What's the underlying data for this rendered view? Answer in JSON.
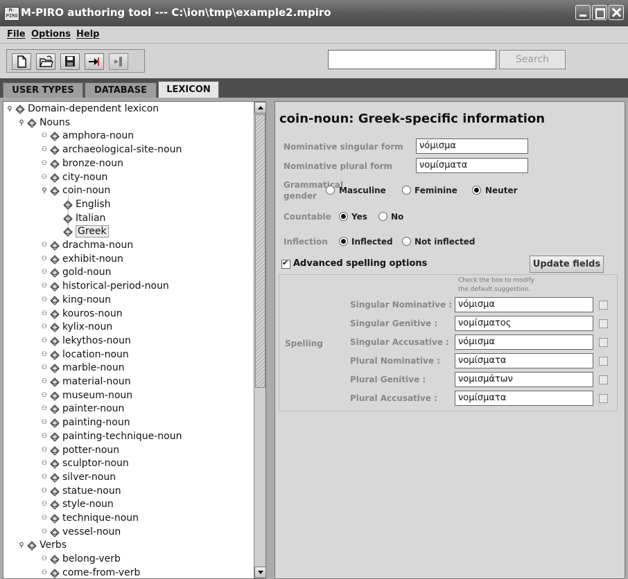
{
  "window": {
    "title": "M-PIRO authoring tool --- C:\\ion\\tmp\\example2.mpiro",
    "app_icon": "M-PIRO"
  },
  "menu": [
    "File",
    "Options",
    "Help"
  ],
  "toolbar": {
    "search_value": "",
    "search_label": "Search"
  },
  "tabs": [
    {
      "label": "USER TYPES",
      "active": false
    },
    {
      "label": "DATABASE",
      "active": false
    },
    {
      "label": "LEXICON",
      "active": true
    }
  ],
  "tree": {
    "root": "Domain-dependent lexicon",
    "nouns_label": "Nouns",
    "nouns": [
      "amphora-noun",
      "archaeological-site-noun",
      "bronze-noun",
      "city-noun",
      "coin-noun"
    ],
    "coin_children": [
      "English",
      "Italian",
      "Greek"
    ],
    "selected": "Greek",
    "nouns_after": [
      "drachma-noun",
      "exhibit-noun",
      "gold-noun",
      "historical-period-noun",
      "king-noun",
      "kouros-noun",
      "kylix-noun",
      "lekythos-noun",
      "location-noun",
      "marble-noun",
      "material-noun",
      "museum-noun",
      "painter-noun",
      "painting-noun",
      "painting-technique-noun",
      "potter-noun",
      "sculptor-noun",
      "silver-noun",
      "statue-noun",
      "style-noun",
      "technique-noun",
      "vessel-noun"
    ],
    "verbs_label": "Verbs",
    "verbs": [
      "belong-verb",
      "come-from-verb"
    ]
  },
  "detail": {
    "title": "coin-noun: Greek-specific information",
    "nom_sing_label": "Nominative singular form",
    "nom_sing_value": "νόμισμα",
    "nom_plur_label": "Nominative plural form",
    "nom_plur_value": "νομίσματα",
    "gender_label_1": "Grammatical",
    "gender_label_2": "gender",
    "gender_options": [
      "Masculine",
      "Feminine",
      "Neuter"
    ],
    "gender_selected": "Neuter",
    "countable_label": "Countable",
    "countable_options": [
      "Yes",
      "No"
    ],
    "countable_selected": "Yes",
    "inflection_label": "Inflection",
    "inflection_options": [
      "Inflected",
      "Not inflected"
    ],
    "inflection_selected": "Inflected",
    "advanced_label": "Advanced spelling options",
    "advanced_checked": true,
    "update_button": "Update fields",
    "hint_1": "Check the box to modify",
    "hint_2": "the default suggestion.",
    "spelling_label": "Spelling",
    "spellings": [
      {
        "label": "Singular Nominative :",
        "value": "νόμισμα"
      },
      {
        "label": "Singular Genitive :",
        "value": "νομίσματος"
      },
      {
        "label": "Singular Accusative :",
        "value": "νόμισμα"
      },
      {
        "label": "Plural Nominative :",
        "value": "νομίσματα"
      },
      {
        "label": "Plural Genitive :",
        "value": "νομισμάτων"
      },
      {
        "label": "Plural Accusative :",
        "value": "νομίσματα"
      }
    ]
  },
  "icons": {
    "tree_node": "book-icon",
    "new": "new-document-icon",
    "open": "open-folder-icon",
    "save": "save-disk-icon",
    "import": "import-arrow-icon",
    "export": "export-icon"
  }
}
